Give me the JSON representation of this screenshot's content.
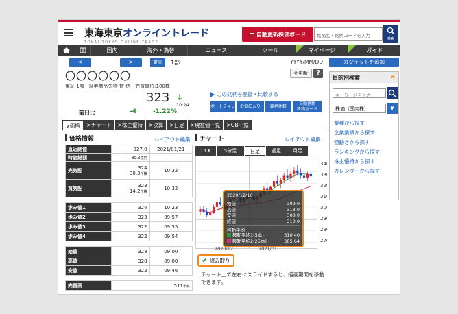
{
  "header": {
    "logo_main_a": "東海東京",
    "logo_main_b": "オンライントレード",
    "logo_sub": "TOKAI TOKYO ONLINE TRADE",
    "auto_update_label": "自動更新株価ボード",
    "search_placeholder": "銘柄名・銘柄コードを入力",
    "search_label": "検索"
  },
  "nav": {
    "items": [
      "国内",
      "海外・為替",
      "ニュース",
      "ツール",
      "マイページ",
      "ガイド"
    ],
    "new_badge": "NEW"
  },
  "stock": {
    "prev_btn": "<",
    "next_btn": ">",
    "market": "東証",
    "section": "1部",
    "date": "YYYY/MM/DD",
    "name": "〇〇〇〇〇〇",
    "info": "東証 1部　証券商品先物 貸 信　売買単位:100株",
    "price": "323",
    "time": "10:24",
    "prev_label": "前日比",
    "change": "-4",
    "change_pct": "-1.22%",
    "refresh_label": "更新",
    "help_label": "?",
    "register_link": "この銘柄を登録・比較する",
    "buttons": [
      "ポートフォリオ",
      "お気に入り",
      "銘柄比較",
      "自動更新\n株価ボード"
    ]
  },
  "tabs": [
    "価格",
    "チャート",
    "株主優待",
    "決算",
    "日足",
    "現在値一覧",
    "GB一覧"
  ],
  "price_info": {
    "title": "価格情報",
    "layout_link": "レイアウト編集",
    "rows": [
      {
        "label": "直近終値",
        "value": "327.0",
        "extra": "2021/01/21"
      },
      {
        "label": "時価総額",
        "value": "852",
        "unit": "億円",
        "extra": ""
      },
      {
        "label": "売気配",
        "value": "324",
        "sub": "30.3",
        "subunit": "千株",
        "extra": "10:32"
      },
      {
        "label": "買気配",
        "value": "323",
        "sub": "14.2",
        "subunit": "千株",
        "extra": "10:32"
      },
      {
        "label": "歩み値1",
        "value": "324",
        "extra": "10:23"
      },
      {
        "label": "歩み値2",
        "value": "323",
        "extra": "09:57"
      },
      {
        "label": "歩み値3",
        "value": "322",
        "extra": "09:55"
      },
      {
        "label": "歩み値4",
        "value": "322",
        "extra": "09:54"
      },
      {
        "label": "始値",
        "value": "328",
        "extra": "09:00"
      },
      {
        "label": "高値",
        "value": "328",
        "extra": "09:00"
      },
      {
        "label": "安値",
        "value": "322",
        "extra": "09:46"
      },
      {
        "label": "売買高",
        "value": "",
        "extra": "511",
        "extraunit": "千株"
      }
    ]
  },
  "chart": {
    "title": "チャート",
    "layout_link": "レイアウト編集",
    "tabs": [
      "TICK",
      "5分足",
      "日足",
      "週足",
      "月足"
    ],
    "y_ticks": [
      "340",
      "330",
      "320",
      "310",
      "300",
      "290",
      "280",
      "270"
    ],
    "x_labels": [
      "2020/12",
      "2021/01"
    ],
    "tooltip": {
      "date": "2020/12/16",
      "rows": [
        {
          "k": "始値",
          "v": "309.0"
        },
        {
          "k": "高値",
          "v": "313.0"
        },
        {
          "k": "安値",
          "v": "308.0"
        },
        {
          "k": "終値",
          "v": "310.0"
        }
      ],
      "ma_title": "移動平均",
      "ma": [
        {
          "name": "移動平均1(5本)",
          "v": "310.40",
          "color": "#2e9a2e"
        },
        {
          "name": "移動平均2(25本)",
          "v": "305.64",
          "color": "#d8307a"
        }
      ]
    },
    "read_label": "読み取り",
    "note": "チャート上で左右にスライドすると、描画期間を移動できます。"
  },
  "sidebar": {
    "gadget_label": "ガジェットを追加",
    "box_title": "目的別検索",
    "close": "×",
    "keyword_placeholder": "キーワードを入力",
    "category": "株価（国内株）",
    "links": [
      "業種から探す",
      "企業業績から探す",
      "値動きから探す",
      "ランキングから探す",
      "株主優待から探す",
      "カレンダーから探す"
    ]
  }
}
